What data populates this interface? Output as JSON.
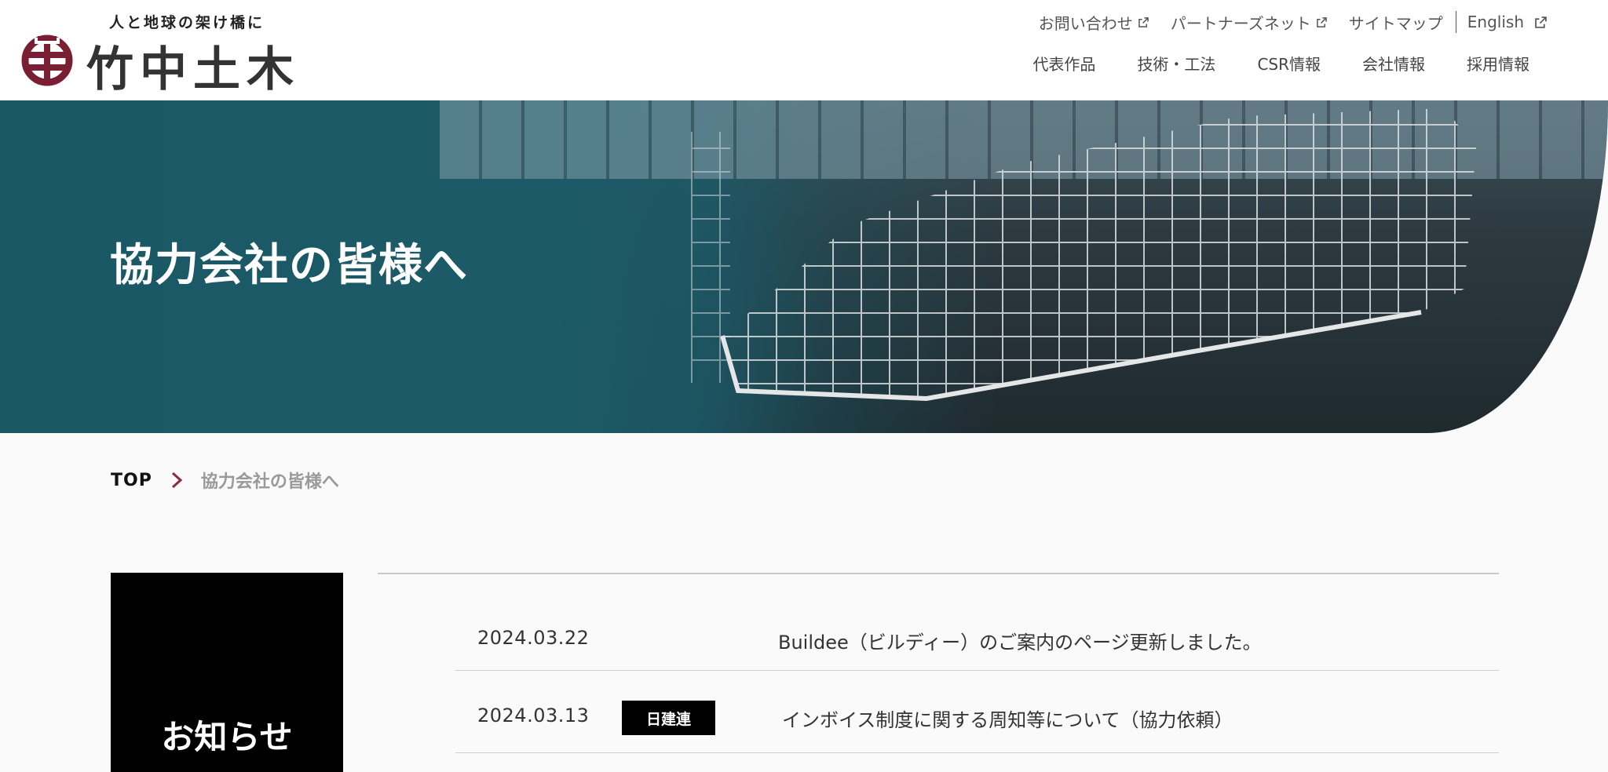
{
  "header": {
    "tagline": "人と地球の架け橋に",
    "company_name": "竹中土木",
    "util_nav": [
      {
        "label": "お問い合わせ",
        "icon": "external-link-icon"
      },
      {
        "label": "パートナーズネット",
        "icon": "external-link-icon"
      },
      {
        "label": "サイトマップ"
      },
      {
        "label": "English",
        "icon": "external-link-icon"
      }
    ],
    "main_nav": [
      "代表作品",
      "技術・工法",
      "CSR情報",
      "会社情報",
      "採用情報"
    ]
  },
  "hero": {
    "title": "協力会社の皆様へ"
  },
  "breadcrumb": {
    "top": "TOP",
    "current": "協力会社の皆様へ"
  },
  "notices": {
    "heading": "お知らせ",
    "items": [
      {
        "date": "2024.03.22",
        "tag": "",
        "text": "Buildee（ビルディー）のご案内のページ更新しました。"
      },
      {
        "date": "2024.03.13",
        "tag": "日建連",
        "text": "インボイス制度に関する周知等について（協力依頼）"
      }
    ]
  },
  "colors": {
    "brand": "#7a1e34",
    "hero_teal": "#1c5a68",
    "breadcrumb_chevron": "#8a2a3c"
  }
}
